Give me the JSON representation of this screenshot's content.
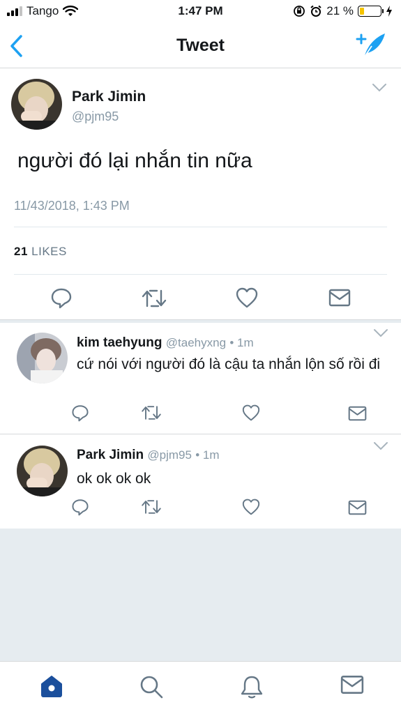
{
  "status_bar": {
    "carrier": "Tango",
    "time": "1:47 PM",
    "battery_percent": "21 %",
    "battery_level": 0.21
  },
  "nav": {
    "title": "Tweet",
    "back_icon": "chevron-left-icon",
    "compose_icon": "compose-feather-icon"
  },
  "tweet": {
    "name": "Park Jimin",
    "handle": "@pjm95",
    "text": "người đó lại nhắn tin nữa",
    "timestamp": "11/43/2018, 1:43 PM",
    "likes_count": "21",
    "likes_label": "LIKES"
  },
  "replies": [
    {
      "name": "kim taehyung",
      "handle": "@taehyxng",
      "time": "• 1m",
      "text": "cứ nói với người đó là cậu ta nhắn lộn số rồi đi"
    },
    {
      "name": "Park Jimin",
      "handle": "@pjm95",
      "time": "• 1m",
      "text": "ok ok ok ok"
    }
  ],
  "colors": {
    "accent": "#1da1f2",
    "muted": "#8899a6",
    "tab_active": "#1b4f9c"
  }
}
